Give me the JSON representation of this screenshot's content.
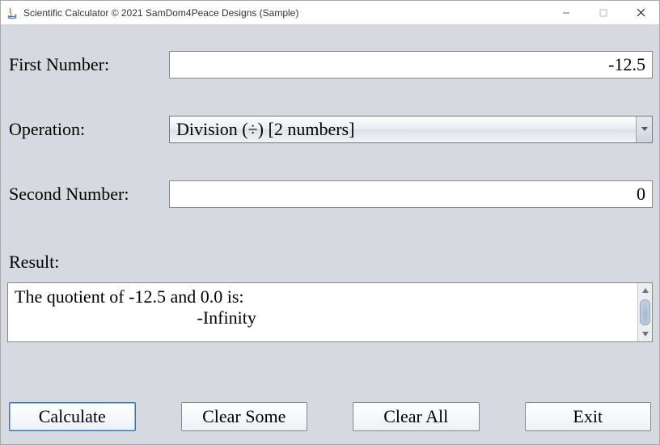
{
  "window": {
    "title": "Scientific Calculator © 2021 SamDom4Peace Designs (Sample)"
  },
  "form": {
    "first_number_label": "First Number:",
    "first_number_value": "-12.5",
    "operation_label": "Operation:",
    "operation_value": "Division (÷) [2 numbers]",
    "second_number_label": "Second Number:",
    "second_number_value": "0",
    "result_label": "Result:",
    "result_text": "The quotient of -12.5 and 0.0 is:\n                                         -Infinity"
  },
  "buttons": {
    "calculate": "Calculate",
    "clear_some": "Clear Some",
    "clear_all": "Clear All",
    "exit": "Exit"
  }
}
